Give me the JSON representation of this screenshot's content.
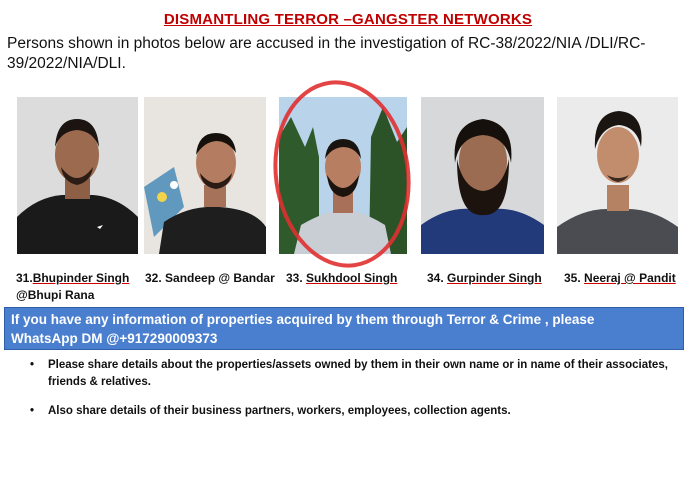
{
  "header": {
    "title": "DISMANTLING TERROR –GANGSTER NETWORKS",
    "intro": "Persons shown in photos below are accused in the investigation of RC-38/2022/NIA  /DLI/RC-39/2022/NIA/DLI."
  },
  "persons": [
    {
      "number": "31.",
      "name": "Bhupinder Singh",
      "alias": "@Bhupi Rana"
    },
    {
      "number": "32.",
      "name": "Sandeep @ Bandar"
    },
    {
      "number": "33.",
      "name": "Sukhdool Singh"
    },
    {
      "number": "34.",
      "name": "Gurpinder Singh"
    },
    {
      "number": "35.",
      "name": "Neeraj @ Pandit"
    }
  ],
  "banner": {
    "line1": "If you have any information  of properties  acquired by them through Terror & Crime , please",
    "line2": "WhatsApp DM @+917290009373"
  },
  "bullets": [
    "Please share details  about the properties/assets owned by them in their own name or in name of their associates, friends & relatives.",
    "Also share details of their business partners, workers, employees, collection agents."
  ],
  "colors": {
    "title": "#c00000",
    "banner_bg": "#4a7fcf",
    "highlight_circle": "#e03030"
  }
}
